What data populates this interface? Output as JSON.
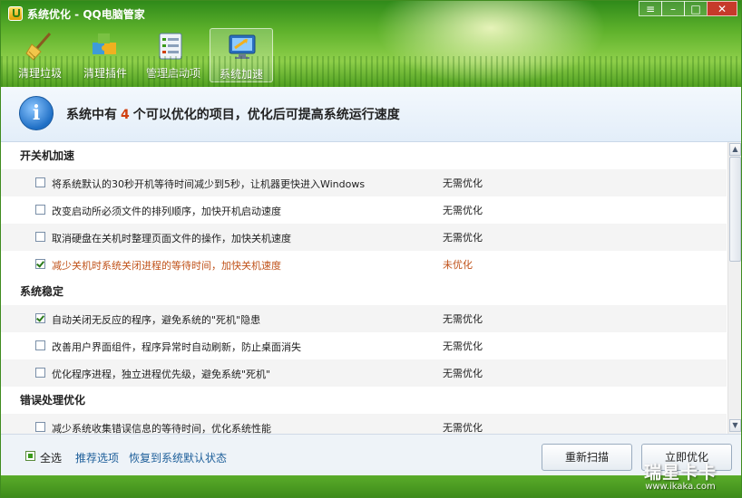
{
  "window": {
    "title": "系统优化 - QQ电脑管家"
  },
  "toolbar": [
    {
      "label": "清理垃圾",
      "icon": "broom-icon"
    },
    {
      "label": "清理插件",
      "icon": "puzzle-icon"
    },
    {
      "label": "管理启动项",
      "icon": "startup-list-icon"
    },
    {
      "label": "系统加速",
      "icon": "monitor-speed-icon",
      "active": true
    }
  ],
  "info": {
    "prefix": "系统中有",
    "count": "4",
    "suffix": "个可以优化的项目，优化后可提高系统运行速度"
  },
  "groups": [
    {
      "title": "开关机加速",
      "items": [
        {
          "text": "将系统默认的30秒开机等待时间减少到5秒，让机器更快进入Windows",
          "status": "无需优化",
          "checked": false
        },
        {
          "text": "改变启动所必须文件的排列顺序，加快开机启动速度",
          "status": "无需优化",
          "checked": false
        },
        {
          "text": "取消硬盘在关机时整理页面文件的操作，加快关机速度",
          "status": "无需优化",
          "checked": false
        },
        {
          "text": "减少关机时系统关闭进程的等待时间，加快关机速度",
          "status": "未优化",
          "checked": true,
          "warn": true
        }
      ]
    },
    {
      "title": "系统稳定",
      "items": [
        {
          "text": "自动关闭无反应的程序，避免系统的\"死机\"隐患",
          "status": "无需优化",
          "checked": true
        },
        {
          "text": "改善用户界面组件，程序异常时自动刷新，防止桌面消失",
          "status": "无需优化",
          "checked": false
        },
        {
          "text": "优化程序进程，独立进程优先级，避免系统\"死机\"",
          "status": "无需优化",
          "checked": false
        }
      ]
    },
    {
      "title": "错误处理优化",
      "items": [
        {
          "text": "减少系统收集错误信息的等待时间，优化系统性能",
          "status": "无需优化",
          "checked": false
        }
      ]
    }
  ],
  "footer": {
    "select_all": "全选",
    "recommend": "推荐选项",
    "restore": "恢复到系统默认状态",
    "rescan": "重新扫描",
    "optimize": "立即优化"
  },
  "watermark": {
    "line1": "瑞星卡卡",
    "line2": "www.ikaka.com"
  },
  "colors": {
    "accent_green": "#4f9f21",
    "warn": "#c0521a",
    "link": "#1e5f9a",
    "count": "#d04010"
  }
}
